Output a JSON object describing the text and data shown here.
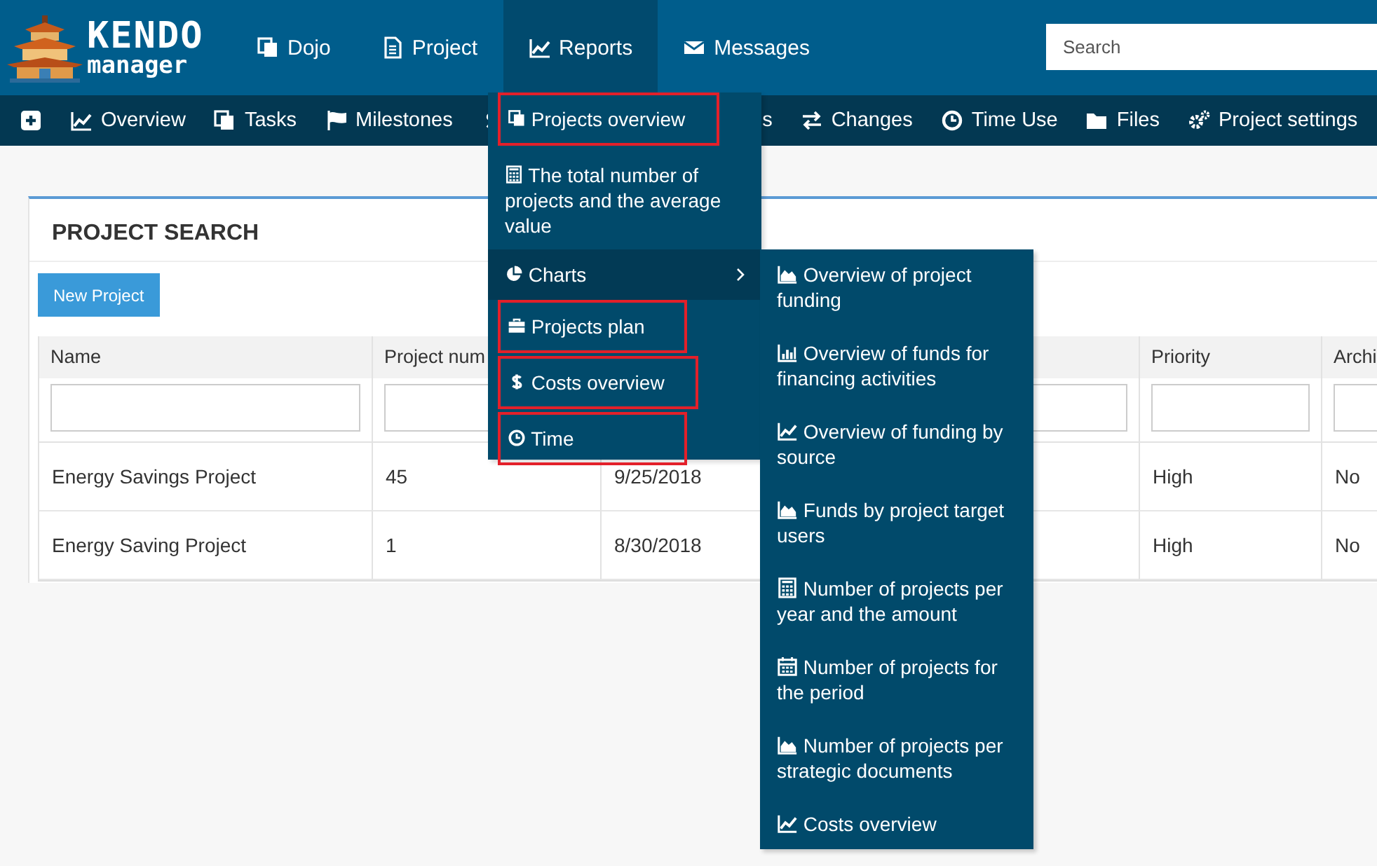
{
  "logo": {
    "title": "KENDO",
    "subtitle": "manager"
  },
  "nav": [
    {
      "label": "Dojo",
      "selected": false
    },
    {
      "label": "Project",
      "selected": false
    },
    {
      "label": "Reports",
      "selected": true
    },
    {
      "label": "Messages",
      "selected": false
    }
  ],
  "search": {
    "placeholder": "Search"
  },
  "subnav": [
    {
      "covered": false
    },
    {
      "label": "Overview",
      "covered": false
    },
    {
      "label": "Tasks",
      "covered": false
    },
    {
      "label": "Milestones",
      "covered": false
    },
    {
      "label": "s",
      "covered": true
    },
    {
      "label": "Changes",
      "covered": false
    },
    {
      "label": "Time Use",
      "covered": false
    },
    {
      "label": "Files",
      "covered": false
    },
    {
      "label": "Project settings",
      "covered": false
    }
  ],
  "reports_menu": [
    {
      "label": "Projects overview",
      "kind": "link",
      "outlined": true,
      "selected": false
    },
    {
      "label": "The total number of projects and the average value",
      "kind": "link",
      "outlined": false,
      "selected": false
    },
    {
      "label": "Charts",
      "kind": "submenu",
      "outlined": false,
      "selected": true
    },
    {
      "label": "Projects plan",
      "kind": "link",
      "outlined": true,
      "selected": false
    },
    {
      "label": "Costs overview",
      "kind": "link",
      "outlined": true,
      "selected": false
    },
    {
      "label": "Time",
      "kind": "link",
      "outlined": true,
      "selected": false
    }
  ],
  "charts_submenu": [
    "Overview of project funding",
    "Overview of funds for financing activities",
    "Overview of funding by source",
    "Funds by project target users",
    "Number of projects per year and the amount",
    "Number of projects for the period",
    "Number of projects per strategic documents",
    "Costs overview"
  ],
  "panel": {
    "title": "PROJECT SEARCH",
    "new_button": "New Project"
  },
  "table": {
    "columns": [
      {
        "label": "Name"
      },
      {
        "label": "Project num"
      },
      {},
      {
        "label": "Priority"
      },
      {
        "label": "Archi"
      }
    ],
    "rows": [
      [
        "Energy Savings Project",
        "45",
        "9/25/2018",
        "High",
        "No"
      ],
      [
        "Energy Saving Project",
        "1",
        "8/30/2018",
        "High",
        "No"
      ]
    ]
  }
}
